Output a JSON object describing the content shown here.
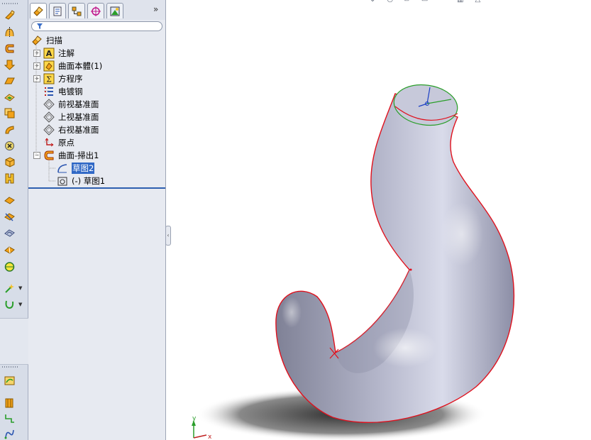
{
  "feature_tree": {
    "root": {
      "label": "扫描",
      "icon": "part-icon"
    },
    "items": [
      {
        "label": "注解",
        "icon": "annotations-icon",
        "expandable": true
      },
      {
        "label": "曲面本體(1)",
        "icon": "surface-bodies-icon",
        "expandable": true
      },
      {
        "label": "方程序",
        "icon": "equations-icon",
        "expandable": true
      },
      {
        "label": "电镀钢",
        "icon": "material-icon",
        "expandable": false
      },
      {
        "label": "前视基准面",
        "icon": "plane-icon",
        "expandable": false
      },
      {
        "label": "上视基准面",
        "icon": "plane-icon",
        "expandable": false
      },
      {
        "label": "右视基准面",
        "icon": "plane-icon",
        "expandable": false
      },
      {
        "label": "原点",
        "icon": "origin-icon",
        "expandable": false
      },
      {
        "label": "曲面-掃出1",
        "icon": "surface-sweep-icon",
        "expandable": true,
        "expanded": true
      },
      {
        "label": "草图2",
        "icon": "sketch-icon",
        "selected": true
      },
      {
        "label": "(-) 草图1",
        "icon": "sketch-profile-icon"
      }
    ]
  },
  "tabs": [
    {
      "name": "featuremanager",
      "icon": "featuremanager-tab-icon"
    },
    {
      "name": "propertymanager",
      "icon": "propertymanager-tab-icon"
    },
    {
      "name": "configurationmanager",
      "icon": "configurationmanager-tab-icon"
    },
    {
      "name": "dimxpert",
      "icon": "dimxpert-tab-icon"
    },
    {
      "name": "display",
      "icon": "display-manager-tab-icon"
    }
  ],
  "more_tabs_glyph": "»",
  "splitter_glyph": "‹",
  "triad": {
    "x_label": "x",
    "y_label": "y"
  },
  "colors": {
    "selection": "#3169c6",
    "edge": "#e0101c",
    "model_gray": "#9ea0b4",
    "sketch_green": "#2a9e2a"
  }
}
